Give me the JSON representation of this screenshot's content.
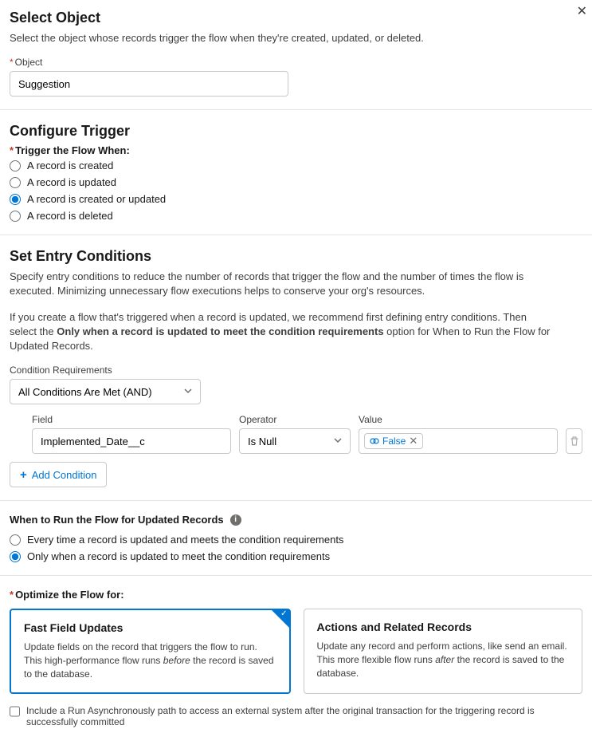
{
  "close_icon": "✕",
  "select_object": {
    "title": "Select Object",
    "desc": "Select the object whose records trigger the flow when they're created, updated, or deleted.",
    "object_label": "Object",
    "object_value": "Suggestion"
  },
  "configure_trigger": {
    "title": "Configure Trigger",
    "label": "Trigger the Flow When:",
    "options": [
      {
        "id": "created",
        "label": "A record is created",
        "checked": false
      },
      {
        "id": "updated",
        "label": "A record is updated",
        "checked": false
      },
      {
        "id": "created_or_updated",
        "label": "A record is created or updated",
        "checked": true
      },
      {
        "id": "deleted",
        "label": "A record is deleted",
        "checked": false
      }
    ]
  },
  "entry_conditions": {
    "title": "Set Entry Conditions",
    "desc1": "Specify entry conditions to reduce the number of records that trigger the flow and the number of times the flow is executed. Minimizing unnecessary flow executions helps to conserve your org's resources.",
    "desc2_pre": "If you create a flow that's triggered when a record is updated, we recommend first defining entry conditions. Then select the ",
    "desc2_bold": "Only when a record is updated to meet the condition requirements",
    "desc2_post": " option for When to Run the Flow for Updated Records.",
    "cond_req_label": "Condition Requirements",
    "cond_req_value": "All Conditions Are Met (AND)",
    "field_label": "Field",
    "operator_label": "Operator",
    "value_label": "Value",
    "field_value": "Implemented_Date__c",
    "operator_value": "Is Null",
    "value_pill": "False",
    "add_condition": "Add Condition"
  },
  "when_run": {
    "title": "When to Run the Flow for Updated Records",
    "options": [
      {
        "label": "Every time a record is updated and meets the condition requirements",
        "checked": false
      },
      {
        "label": "Only when a record is updated to meet the condition requirements",
        "checked": true
      }
    ]
  },
  "optimize": {
    "label": "Optimize the Flow for:",
    "cards": [
      {
        "title": "Fast Field Updates",
        "desc_pre": "Update fields on the record that triggers the flow to run. This high-performance flow runs ",
        "desc_em": "before",
        "desc_post": " the record is saved to the database.",
        "selected": true
      },
      {
        "title": "Actions and Related Records",
        "desc_pre": "Update any record and perform actions, like send an email. This more flexible flow runs ",
        "desc_em": "after",
        "desc_post": " the record is saved to the database.",
        "selected": false
      }
    ],
    "async_label": "Include a Run Asynchronously path to access an external system after the original transaction for the triggering record is successfully committed"
  }
}
